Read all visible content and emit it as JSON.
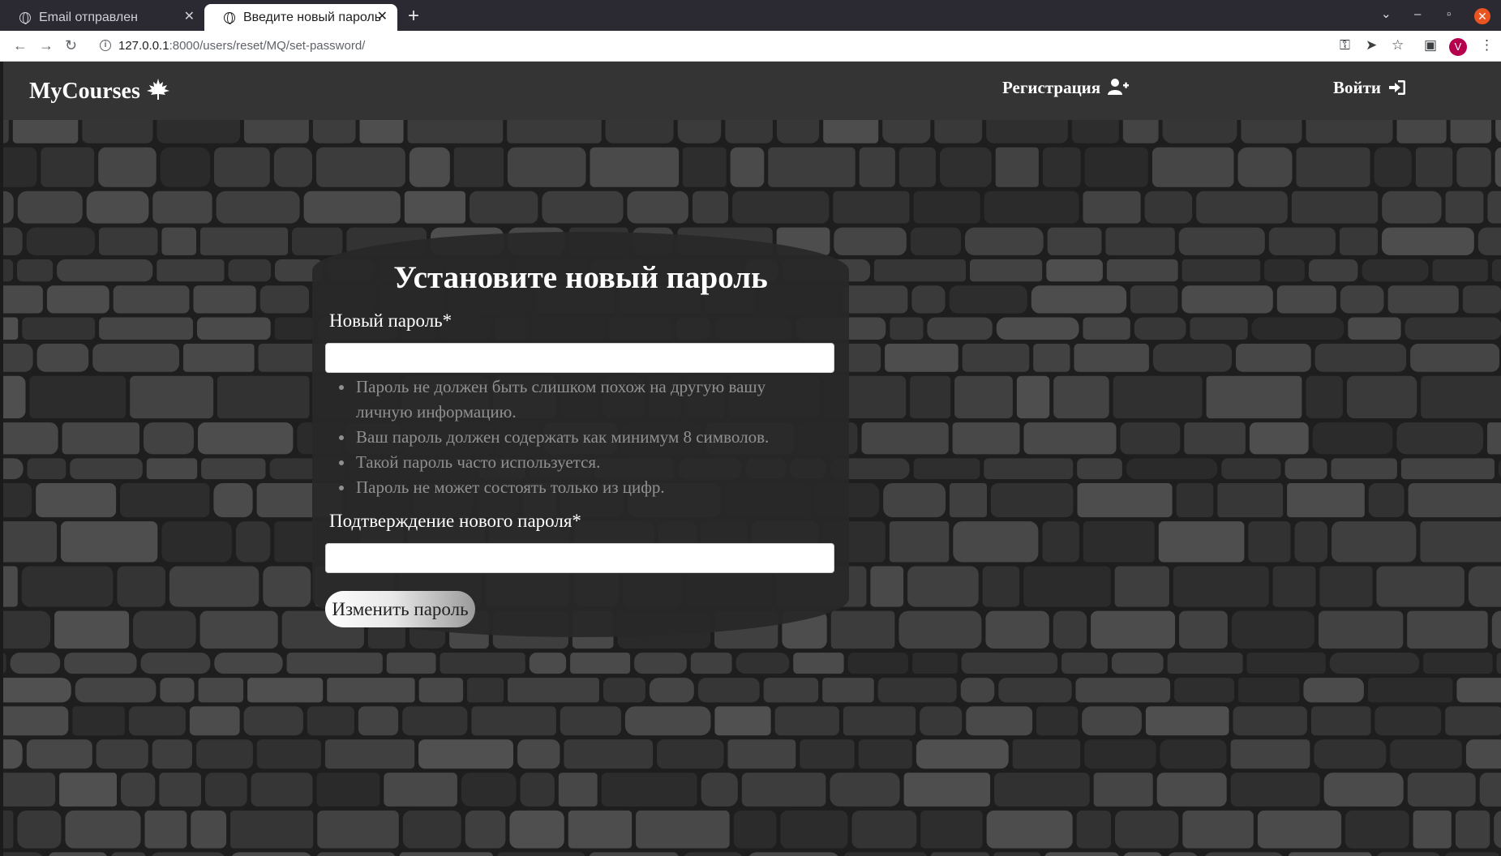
{
  "browser": {
    "tabs": [
      {
        "title": "Email отправлен",
        "active": false
      },
      {
        "title": "Введите новый пароль",
        "active": true
      }
    ],
    "url_host": "127.0.0.1",
    "url_rest": ":8000/users/reset/MQ/set-password/",
    "profile_initial": "V",
    "colors": {
      "tabbar": "#2b2a33",
      "close": "#e95420",
      "profile": "#b5004e"
    }
  },
  "navbar": {
    "brand": "MyCourses",
    "brand_icon": "leaf-icon",
    "register_label": "Регистрация",
    "register_icon": "user-plus-icon",
    "login_label": "Войти",
    "login_icon": "sign-in-icon",
    "background": "#343434"
  },
  "form": {
    "title": "Установите новый пароль",
    "new_password_label": "Новый пароль*",
    "new_password_value": "",
    "hints": [
      "Пароль не должен быть слишком похож на другую вашу личную информацию.",
      "Ваш пароль должен содержать как минимум 8 символов.",
      "Такой пароль часто используется.",
      "Пароль не может состоять только из цифр."
    ],
    "confirm_password_label": "Подтверждение нового пароля*",
    "confirm_password_value": "",
    "submit_label": "Изменить пароль"
  }
}
